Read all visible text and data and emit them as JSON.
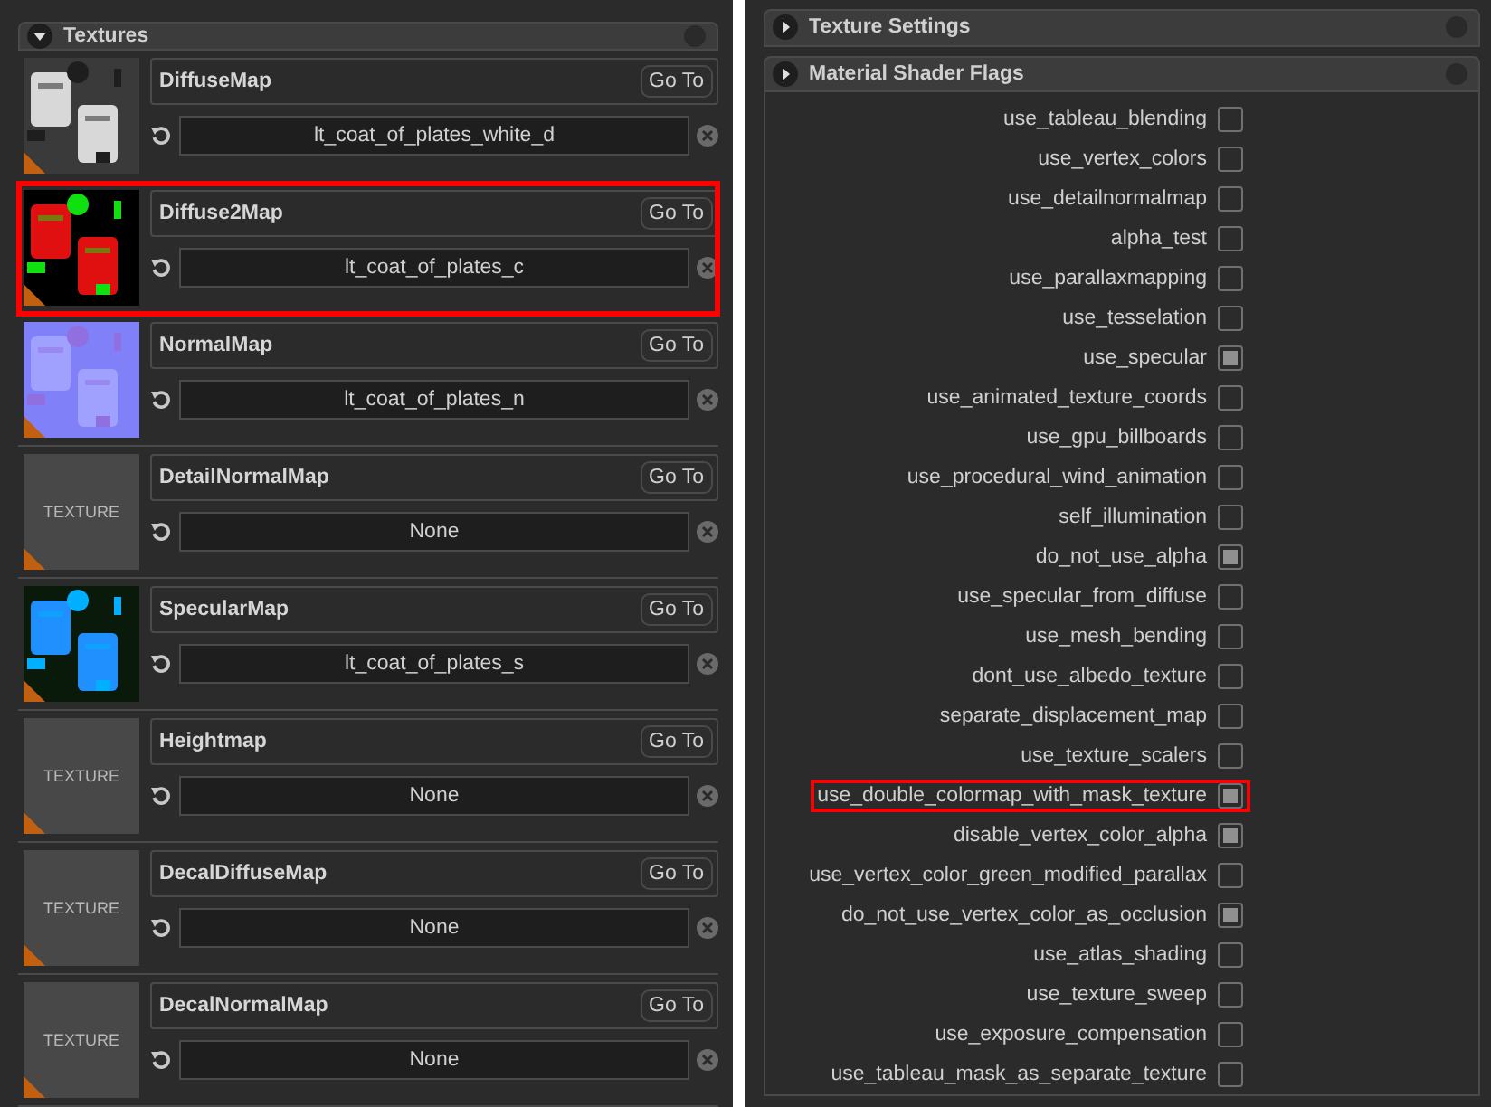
{
  "textures_panel": {
    "title": "Textures",
    "expanded": true,
    "slots": [
      {
        "name": "DiffuseMap",
        "button": "Go To",
        "value": "lt_coat_of_plates_white_d",
        "highlighted": false
      },
      {
        "name": "Diffuse2Map",
        "button": "Go To",
        "value": "lt_coat_of_plates_c",
        "highlighted": true
      },
      {
        "name": "NormalMap",
        "button": "Go To",
        "value": "lt_coat_of_plates_n",
        "highlighted": false
      },
      {
        "name": "DetailNormalMap",
        "thumbnail": {
          "kind": "placeholder",
          "label": "TEXTURE"
        },
        "button": "Go To",
        "value": "None",
        "highlighted": false
      },
      {
        "name": "SpecularMap",
        "button": "Go To",
        "value": "lt_coat_of_plates_s",
        "highlighted": false
      },
      {
        "name": "Heightmap",
        "thumbnail": {
          "kind": "placeholder",
          "label": "TEXTURE"
        },
        "button": "Go To",
        "value": "None",
        "highlighted": false
      },
      {
        "name": "DecalDiffuseMap",
        "thumbnail": {
          "kind": "placeholder",
          "label": "TEXTURE"
        },
        "button": "Go To",
        "value": "None",
        "highlighted": false
      },
      {
        "name": "DecalNormalMap",
        "thumbnail": {
          "kind": "placeholder",
          "label": "TEXTURE"
        },
        "button": "Go To",
        "value": "None",
        "highlighted": false
      }
    ]
  },
  "sections": [
    {
      "title": "Texture Settings",
      "expanded": false
    },
    {
      "title": "Material Shader Flags",
      "expanded": false
    }
  ],
  "flags": [
    {
      "label": "use_tableau_blending",
      "checked": false,
      "highlighted": false
    },
    {
      "label": "use_vertex_colors",
      "checked": false,
      "highlighted": false
    },
    {
      "label": "use_detailnormalmap",
      "checked": false,
      "highlighted": false
    },
    {
      "label": "alpha_test",
      "checked": false,
      "highlighted": false
    },
    {
      "label": "use_parallaxmapping",
      "checked": false,
      "highlighted": false
    },
    {
      "label": "use_tesselation",
      "checked": false,
      "highlighted": false
    },
    {
      "label": "use_specular",
      "checked": true,
      "highlighted": false
    },
    {
      "label": "use_animated_texture_coords",
      "checked": false,
      "highlighted": false
    },
    {
      "label": "use_gpu_billboards",
      "checked": false,
      "highlighted": false
    },
    {
      "label": "use_procedural_wind_animation",
      "checked": false,
      "highlighted": false
    },
    {
      "label": "self_illumination",
      "checked": false,
      "highlighted": false
    },
    {
      "label": "do_not_use_alpha",
      "checked": true,
      "highlighted": false
    },
    {
      "label": "use_specular_from_diffuse",
      "checked": false,
      "highlighted": false
    },
    {
      "label": "use_mesh_bending",
      "checked": false,
      "highlighted": false
    },
    {
      "label": "dont_use_albedo_texture",
      "checked": false,
      "highlighted": false
    },
    {
      "label": "separate_displacement_map",
      "checked": false,
      "highlighted": false
    },
    {
      "label": "use_texture_scalers",
      "checked": false,
      "highlighted": false
    },
    {
      "label": "use_double_colormap_with_mask_texture",
      "checked": true,
      "highlighted": true
    },
    {
      "label": "disable_vertex_color_alpha",
      "checked": true,
      "highlighted": false
    },
    {
      "label": "use_vertex_color_green_modified_parallax",
      "checked": false,
      "highlighted": false
    },
    {
      "label": "do_not_use_vertex_color_as_occlusion",
      "checked": true,
      "highlighted": false
    },
    {
      "label": "use_atlas_shading",
      "checked": false,
      "highlighted": false
    },
    {
      "label": "use_texture_sweep",
      "checked": false,
      "highlighted": false
    },
    {
      "label": "use_exposure_compensation",
      "checked": false,
      "highlighted": false
    },
    {
      "label": "use_tableau_mask_as_separate_texture",
      "checked": false,
      "highlighted": false
    }
  ]
}
